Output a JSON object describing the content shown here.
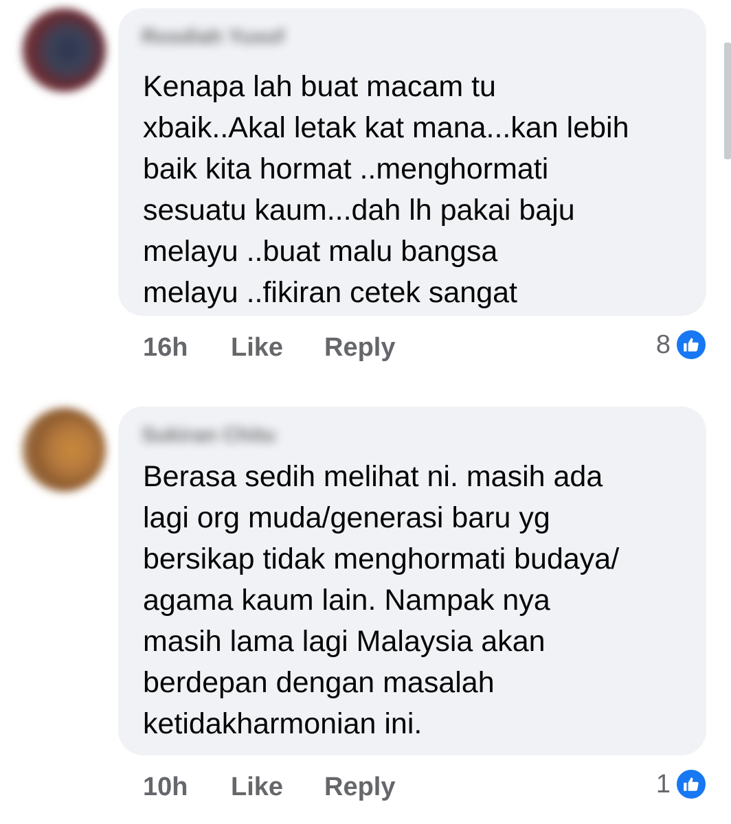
{
  "comments": [
    {
      "author": "Rosdiah Yusof",
      "text": "Kenapa lah buat macam tu\nxbaik..Akal letak kat mana...kan lebih\nbaik kita hormat ..menghormati\nsesuatu kaum...dah lh pakai baju\nmelayu ..buat malu bangsa\nmelayu ..fikiran cetek sangat",
      "time": "16h",
      "like_label": "Like",
      "reply_label": "Reply",
      "reaction_count": "8",
      "reaction_icon": "thumbs-up-icon"
    },
    {
      "author": "Sukiran Chitu",
      "text": "Berasa sedih melihat ni. masih ada\nlagi org muda/generasi baru yg\nbersikap tidak menghormati budaya/\nagama kaum lain. Nampak nya\nmasih lama lagi Malaysia akan\nberdepan dengan masalah\nketidakharmonian ini.",
      "time": "10h",
      "like_label": "Like",
      "reply_label": "Reply",
      "reaction_count": "1",
      "reaction_icon": "thumbs-up-icon"
    }
  ],
  "colors": {
    "bubble": "#f0f2f5",
    "text": "#050505",
    "muted": "#65676b",
    "like_blue": "#1877f2"
  }
}
